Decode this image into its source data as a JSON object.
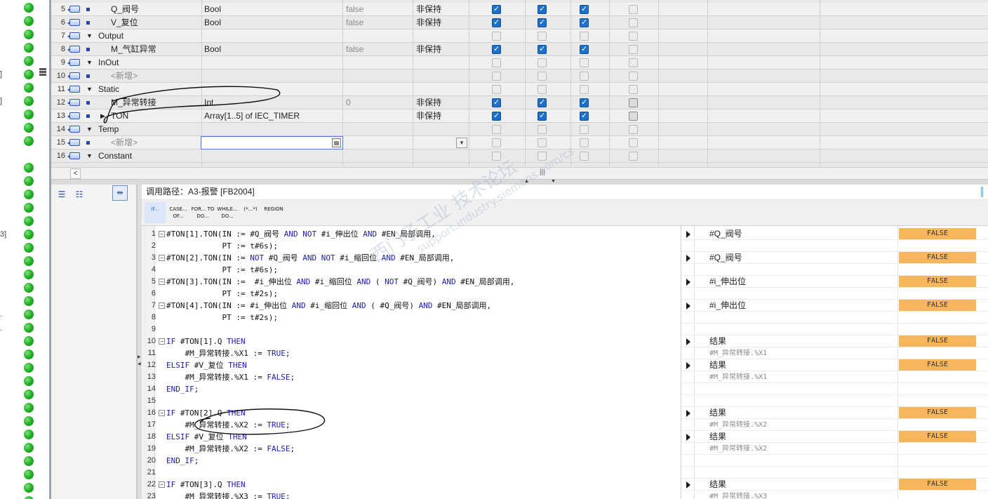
{
  "left_rail": {
    "edge_glyphs": [
      "]",
      "]",
      "3]",
      ".",
      "."
    ]
  },
  "interface_table": {
    "rows": [
      {
        "num": "5",
        "kind": "var",
        "name": "Q_阀号",
        "type": "Bool",
        "default": "false",
        "retain": "非保持",
        "checks": [
          "on",
          "on",
          "on",
          "off"
        ]
      },
      {
        "num": "6",
        "kind": "var",
        "name": "V_复位",
        "type": "Bool",
        "default": "false",
        "retain": "非保持",
        "checks": [
          "on",
          "on",
          "on",
          "off"
        ]
      },
      {
        "num": "7",
        "kind": "section",
        "name": "Output",
        "type": "",
        "default": "",
        "retain": "",
        "checks": [
          "off",
          "off",
          "off",
          "off"
        ]
      },
      {
        "num": "8",
        "kind": "var",
        "name": "M_气缸异常",
        "type": "Bool",
        "default": "false",
        "retain": "非保持",
        "checks": [
          "on",
          "on",
          "on",
          "off"
        ]
      },
      {
        "num": "9",
        "kind": "section",
        "name": "InOut",
        "type": "",
        "default": "",
        "retain": "",
        "checks": [
          "off",
          "off",
          "off",
          "off"
        ]
      },
      {
        "num": "10",
        "kind": "new",
        "name": "<新增>",
        "type": "",
        "default": "",
        "retain": "",
        "checks": [
          "off",
          "off",
          "off",
          "off"
        ]
      },
      {
        "num": "11",
        "kind": "section",
        "name": "Static",
        "type": "",
        "default": "",
        "retain": "",
        "checks": [
          "off",
          "off",
          "off",
          "off"
        ]
      },
      {
        "num": "12",
        "kind": "var",
        "name": "M_异常转接",
        "type": "Int",
        "default": "0",
        "retain": "非保持",
        "checks": [
          "on",
          "on",
          "on",
          "dim"
        ]
      },
      {
        "num": "13",
        "kind": "struct",
        "name": "TON",
        "type": "Array[1..5] of IEC_TIMER",
        "default": "",
        "retain": "非保持",
        "checks": [
          "on",
          "on",
          "on",
          "dim"
        ]
      },
      {
        "num": "14",
        "kind": "section",
        "name": "Temp",
        "type": "",
        "default": "",
        "retain": "",
        "checks": [
          "off",
          "off",
          "off",
          "off"
        ]
      },
      {
        "num": "15",
        "kind": "new",
        "name": "<新增>",
        "type": "",
        "default": "",
        "retain": "",
        "checks": [
          "off",
          "off",
          "off",
          "off"
        ]
      },
      {
        "num": "16",
        "kind": "section",
        "name": "Constant",
        "type": "",
        "default": "",
        "retain": "",
        "checks": [
          "off",
          "off",
          "off",
          "off"
        ]
      }
    ]
  },
  "call_path": {
    "label": "调用路径：A3-报警 [FB2004]"
  },
  "control_toolbar": [
    {
      "label": "IF..."
    },
    {
      "label": "CASE... OF..."
    },
    {
      "label": "FOR... TO DO..."
    },
    {
      "label": "WHILE... DO..."
    },
    {
      "label": "(*...*)"
    },
    {
      "label": "REGION"
    }
  ],
  "code_lines": [
    {
      "n": "1",
      "fold": "−",
      "text": "#TON[1].TON(IN := #Q_阀号 AND NOT #i_伸出位 AND #EN_局部调用,"
    },
    {
      "n": "2",
      "fold": "",
      "text": "            PT := t#6s);"
    },
    {
      "n": "3",
      "fold": "−",
      "text": "#TON[2].TON(IN := NOT #Q_阀号 AND NOT #i_缩回位 AND #EN_局部调用,"
    },
    {
      "n": "4",
      "fold": "",
      "text": "            PT := t#6s);"
    },
    {
      "n": "5",
      "fold": "−",
      "text": "#TON[3].TON(IN :=  #i_伸出位 AND #i_缩回位 AND ( NOT #Q_阀号) AND #EN_局部调用,"
    },
    {
      "n": "6",
      "fold": "",
      "text": "            PT := t#2s);"
    },
    {
      "n": "7",
      "fold": "−",
      "text": "#TON[4].TON(IN := #i_伸出位 AND #i_缩回位 AND ( #Q_阀号) AND #EN_局部调用,"
    },
    {
      "n": "8",
      "fold": "",
      "text": "            PT := t#2s);"
    },
    {
      "n": "9",
      "fold": "",
      "text": ""
    },
    {
      "n": "10",
      "fold": "−",
      "text": "IF #TON[1].Q THEN"
    },
    {
      "n": "11",
      "fold": "",
      "text": "    #M_异常转接.%X1 := TRUE;"
    },
    {
      "n": "12",
      "fold": "",
      "text": "ELSIF #V_复位 THEN"
    },
    {
      "n": "13",
      "fold": "",
      "text": "    #M_异常转接.%X1 := FALSE;"
    },
    {
      "n": "14",
      "fold": "",
      "text": "END_IF;"
    },
    {
      "n": "15",
      "fold": "",
      "text": ""
    },
    {
      "n": "16",
      "fold": "−",
      "text": "IF #TON[2].Q THEN"
    },
    {
      "n": "17",
      "fold": "",
      "text": "    #M_异常转接.%X2 := TRUE;"
    },
    {
      "n": "18",
      "fold": "",
      "text": "ELSIF #V_复位 THEN"
    },
    {
      "n": "19",
      "fold": "",
      "text": "    #M_异常转接.%X2 := FALSE;"
    },
    {
      "n": "20",
      "fold": "",
      "text": "END_IF;"
    },
    {
      "n": "21",
      "fold": "",
      "text": ""
    },
    {
      "n": "22",
      "fold": "−",
      "text": "IF #TON[3].Q THEN"
    },
    {
      "n": "23",
      "fold": "",
      "text": "    #M_异常转接.%X3 := TRUE;"
    }
  ],
  "watch_rows": [
    {
      "arrow": true,
      "name": "#Q_阀号",
      "sub": false,
      "value": "FALSE"
    },
    {
      "arrow": false,
      "name": "",
      "sub": false,
      "value": ""
    },
    {
      "arrow": true,
      "name": "#Q_阀号",
      "sub": false,
      "value": "FALSE"
    },
    {
      "arrow": false,
      "name": "",
      "sub": false,
      "value": ""
    },
    {
      "arrow": true,
      "name": "#i_伸出位",
      "sub": false,
      "value": "FALSE"
    },
    {
      "arrow": false,
      "name": "",
      "sub": false,
      "value": ""
    },
    {
      "arrow": true,
      "name": "#i_伸出位",
      "sub": false,
      "value": "FALSE"
    },
    {
      "arrow": false,
      "name": "",
      "sub": false,
      "value": ""
    },
    {
      "arrow": false,
      "name": "",
      "sub": false,
      "value": ""
    },
    {
      "arrow": true,
      "name": "结果",
      "sub": false,
      "value": "FALSE"
    },
    {
      "arrow": false,
      "name": "#M_异常转接.%X1",
      "sub": true,
      "value": ""
    },
    {
      "arrow": true,
      "name": "结果",
      "sub": false,
      "value": "FALSE"
    },
    {
      "arrow": false,
      "name": "#M_异常转接.%X1",
      "sub": true,
      "value": ""
    },
    {
      "arrow": false,
      "name": "",
      "sub": false,
      "value": ""
    },
    {
      "arrow": false,
      "name": "",
      "sub": false,
      "value": ""
    },
    {
      "arrow": true,
      "name": "结果",
      "sub": false,
      "value": "FALSE"
    },
    {
      "arrow": false,
      "name": "#M_异常转接.%X2",
      "sub": true,
      "value": ""
    },
    {
      "arrow": true,
      "name": "结果",
      "sub": false,
      "value": "FALSE"
    },
    {
      "arrow": false,
      "name": "#M_异常转接.%X2",
      "sub": true,
      "value": ""
    },
    {
      "arrow": false,
      "name": "",
      "sub": false,
      "value": ""
    },
    {
      "arrow": false,
      "name": "",
      "sub": false,
      "value": ""
    },
    {
      "arrow": true,
      "name": "结果",
      "sub": false,
      "value": "FALSE"
    },
    {
      "arrow": false,
      "name": "#M_异常转接.%X3",
      "sub": true,
      "value": ""
    }
  ],
  "watermark": {
    "line1": "西门子工业 技术论坛",
    "line2": "support.industry.siemens.com/cs"
  },
  "colors": {
    "monitor_false": "#f7b65c",
    "checkbox_on": "#1e70c8",
    "status_ok": "#22b022"
  }
}
